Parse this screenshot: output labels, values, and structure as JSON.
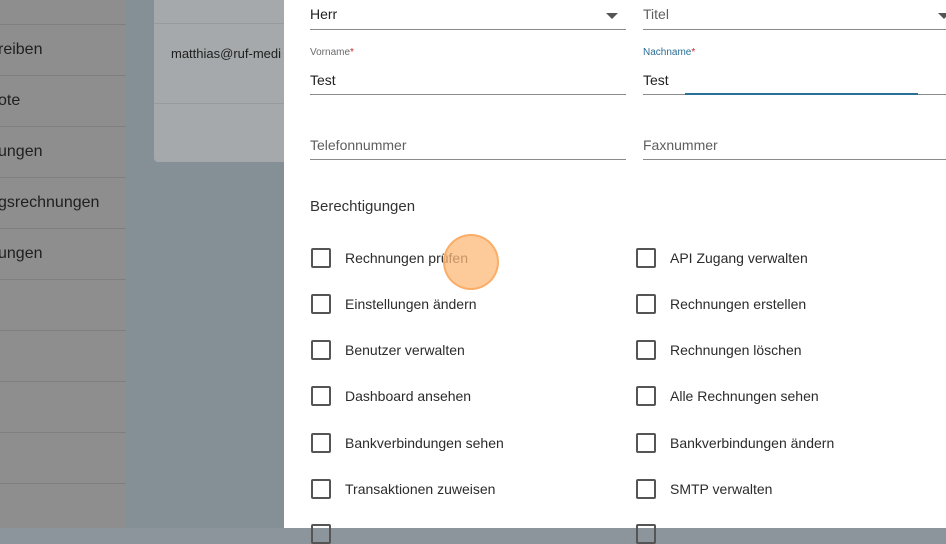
{
  "sidebar": {
    "items": [
      {
        "label": "reiben"
      },
      {
        "label": "ote"
      },
      {
        "label": "ungen"
      },
      {
        "label": "gsrechnungen"
      },
      {
        "label": "ungen"
      },
      {
        "label": ""
      },
      {
        "label": ""
      },
      {
        "label": ""
      },
      {
        "label": ""
      },
      {
        "label": ""
      }
    ]
  },
  "background_card": {
    "email": "matthias@ruf-medi"
  },
  "form": {
    "salutation": {
      "value": "Herr"
    },
    "title": {
      "placeholder": "Titel"
    },
    "first_name": {
      "label": "Vorname",
      "required_mark": "*",
      "value": "Test"
    },
    "last_name": {
      "label": "Nachname",
      "required_mark": "*",
      "value": "Test"
    },
    "phone": {
      "placeholder": "Telefonnummer"
    },
    "fax": {
      "placeholder": "Faxnummer"
    },
    "permissions_title": "Berechtigungen",
    "permissions_left": [
      "Rechnungen prüfen",
      "Einstellungen ändern",
      "Benutzer verwalten",
      "Dashboard ansehen",
      "Bankverbindungen sehen",
      "Transaktionen zuweisen"
    ],
    "permissions_right": [
      "API Zugang verwalten",
      "Rechnungen erstellen",
      "Rechnungen löschen",
      "Alle Rechnungen sehen",
      "Bankverbindungen ändern",
      "SMTP verwalten"
    ]
  },
  "colors": {
    "accent": "#2a6f97",
    "required": "#c62828",
    "click_indicator": "#fcba78"
  }
}
